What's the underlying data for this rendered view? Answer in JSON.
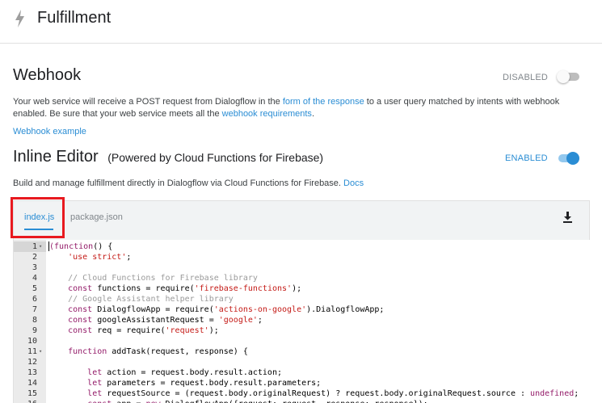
{
  "header": {
    "title": "Fulfillment",
    "icon": "bolt-icon"
  },
  "webhook": {
    "title": "Webhook",
    "status_label": "DISABLED",
    "desc_1": "Your web service will receive a POST request from Dialogflow in the ",
    "link_1": "form of the response",
    "desc_2": " to a user query matched by intents with webhook",
    "desc_3": "enabled. Be sure that your web service meets all the ",
    "link_2": "webhook requirements",
    "desc_4": ".",
    "example_link": "Webhook example"
  },
  "inline_editor": {
    "title": "Inline Editor",
    "subtitle": "(Powered by Cloud Functions for Firebase)",
    "status_label": "ENABLED",
    "desc": "Build and manage fulfillment directly in Dialogflow via Cloud Functions for Firebase. ",
    "docs_link": "Docs",
    "tabs": [
      "index.js",
      "package.json"
    ],
    "download_icon": "download-icon"
  },
  "colors": {
    "accent": "#2a8dd4",
    "highlight": "#e8191f"
  },
  "code_lines": [
    {
      "n": "1",
      "fold": true,
      "segments": [
        [
          "k",
          "(function"
        ],
        [
          "p",
          "() {"
        ]
      ]
    },
    {
      "n": "2",
      "segments": [
        [
          "p",
          "    "
        ],
        [
          "s",
          "'use strict'"
        ],
        [
          "p",
          ";"
        ]
      ]
    },
    {
      "n": "3",
      "segments": []
    },
    {
      "n": "4",
      "segments": [
        [
          "p",
          "    "
        ],
        [
          "c",
          "// Cloud Functions for Firebase library"
        ]
      ]
    },
    {
      "n": "5",
      "segments": [
        [
          "p",
          "    "
        ],
        [
          "k",
          "const"
        ],
        [
          "p",
          " functions = require("
        ],
        [
          "s",
          "'firebase-functions'"
        ],
        [
          "p",
          ");"
        ]
      ]
    },
    {
      "n": "6",
      "segments": [
        [
          "p",
          "    "
        ],
        [
          "c",
          "// Google Assistant helper library"
        ]
      ]
    },
    {
      "n": "7",
      "segments": [
        [
          "p",
          "    "
        ],
        [
          "k",
          "const"
        ],
        [
          "p",
          " DialogflowApp = require("
        ],
        [
          "s",
          "'actions-on-google'"
        ],
        [
          "p",
          ").DialogflowApp;"
        ]
      ]
    },
    {
      "n": "8",
      "segments": [
        [
          "p",
          "    "
        ],
        [
          "k",
          "const"
        ],
        [
          "p",
          " googleAssistantRequest = "
        ],
        [
          "s",
          "'google'"
        ],
        [
          "p",
          ";"
        ]
      ]
    },
    {
      "n": "9",
      "segments": [
        [
          "p",
          "    "
        ],
        [
          "k",
          "const"
        ],
        [
          "p",
          " req = require("
        ],
        [
          "s",
          "'request'"
        ],
        [
          "p",
          ");"
        ]
      ]
    },
    {
      "n": "10",
      "segments": []
    },
    {
      "n": "11",
      "fold": true,
      "segments": [
        [
          "p",
          "    "
        ],
        [
          "k",
          "function"
        ],
        [
          "p",
          " addTask(request, response) {"
        ]
      ]
    },
    {
      "n": "12",
      "segments": []
    },
    {
      "n": "13",
      "segments": [
        [
          "p",
          "        "
        ],
        [
          "k",
          "let"
        ],
        [
          "p",
          " action = request.body.result.action;"
        ]
      ]
    },
    {
      "n": "14",
      "segments": [
        [
          "p",
          "        "
        ],
        [
          "k",
          "let"
        ],
        [
          "p",
          " parameters = request.body.result.parameters;"
        ]
      ]
    },
    {
      "n": "15",
      "segments": [
        [
          "p",
          "        "
        ],
        [
          "k",
          "let"
        ],
        [
          "p",
          " requestSource = (request.body.originalRequest) ? request.body.originalRequest.source : "
        ],
        [
          "k",
          "undefined"
        ],
        [
          "p",
          ";"
        ]
      ]
    },
    {
      "n": "16",
      "segments": [
        [
          "p",
          "        "
        ],
        [
          "k",
          "const"
        ],
        [
          "p",
          " app = "
        ],
        [
          "k",
          "new"
        ],
        [
          "p",
          " DialogflowApp({request: request, response: response});"
        ]
      ]
    }
  ]
}
